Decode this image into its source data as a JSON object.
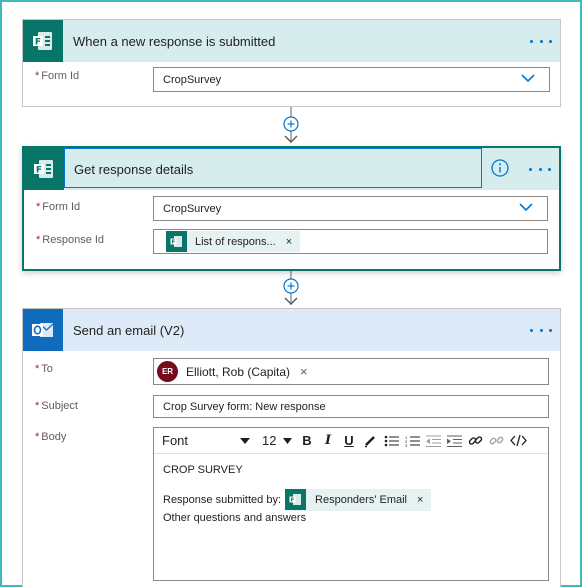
{
  "trigger": {
    "title": "When a new response is submitted",
    "form_label": "Form Id",
    "form_value": "CropSurvey"
  },
  "get_details": {
    "title": "Get response details",
    "form_label": "Form Id",
    "form_value": "CropSurvey",
    "response_label": "Response Id",
    "response_token": "List of respons..."
  },
  "email": {
    "title": "Send an email (V2)",
    "to_label": "To",
    "to_initials": "ER",
    "to_name": "Elliott, Rob (Capita)",
    "subject_label": "Subject",
    "subject_value": "Crop Survey form: New response",
    "body_label": "Body",
    "toolbar": {
      "font": "Font",
      "size": "12"
    },
    "body_line1": "CROP SURVEY",
    "body_line2": "Response submitted by:",
    "body_token": "Responders' Email",
    "body_line3": "Other questions and answers"
  },
  "required_mark": "*",
  "token_remove": "×",
  "colors": {
    "forms_green": "#077568",
    "forms_header": "#d7ecec",
    "outlook_header": "#dcebf7",
    "outlook_blue": "#0f6cbd",
    "accent": "#0078d4",
    "avatar": "#750b1c"
  }
}
